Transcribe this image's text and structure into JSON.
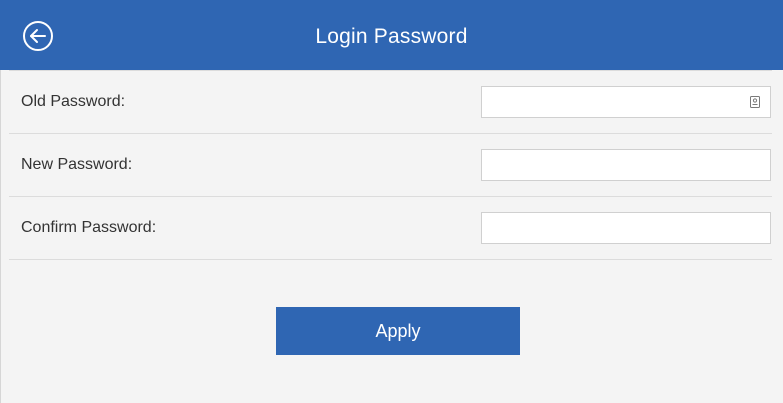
{
  "header": {
    "title": "Login Password",
    "back_icon": "arrow-left-circle-icon",
    "background_color": "#2f66b3"
  },
  "form": {
    "fields": [
      {
        "label": "Old Password:",
        "value": "",
        "placeholder": ""
      },
      {
        "label": "New Password:",
        "value": "",
        "placeholder": ""
      },
      {
        "label": "Confirm Password:",
        "value": "",
        "placeholder": ""
      }
    ],
    "autofill_icon": "keychain-autofill-icon",
    "apply_label": "Apply",
    "accent_color": "#2f66b3"
  }
}
